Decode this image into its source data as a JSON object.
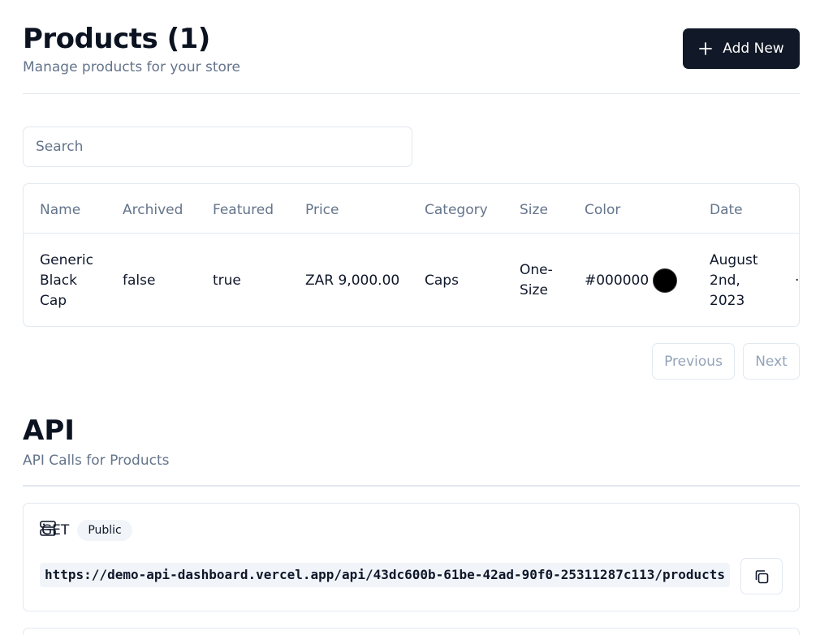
{
  "header": {
    "title": "Products (1)",
    "subtitle": "Manage products for your store",
    "add_label": "Add New"
  },
  "search": {
    "placeholder": "Search",
    "value": ""
  },
  "table": {
    "columns": [
      "Name",
      "Archived",
      "Featured",
      "Price",
      "Category",
      "Size",
      "Color",
      "Date"
    ],
    "rows": [
      {
        "name": "Generic Black Cap",
        "name_lines": [
          "Generic",
          "Black",
          "Cap"
        ],
        "archived": "false",
        "featured": "true",
        "price": "ZAR 9,000.00",
        "category": "Caps",
        "size_lines": [
          "One-",
          "Size"
        ],
        "color": "#000000",
        "date_lines": [
          "August",
          "2nd,",
          "2023"
        ],
        "action": "·"
      }
    ]
  },
  "pagination": {
    "previous_label": "Previous",
    "next_label": "Next"
  },
  "api": {
    "title": "API",
    "subtitle": "API Calls for Products",
    "endpoints": [
      {
        "method": "GET",
        "badge": "Public",
        "url": "https://demo-api-dashboard.vercel.app/api/43dc600b-61be-42ad-90f0-25311287c113/products"
      }
    ]
  },
  "colors": {
    "primary": "#111827",
    "muted_text": "#64748b",
    "border": "#e2e8f0",
    "swatch": "#000000"
  },
  "icons": {
    "add": "plus-icon",
    "server": "server-icon",
    "copy": "copy-icon"
  }
}
